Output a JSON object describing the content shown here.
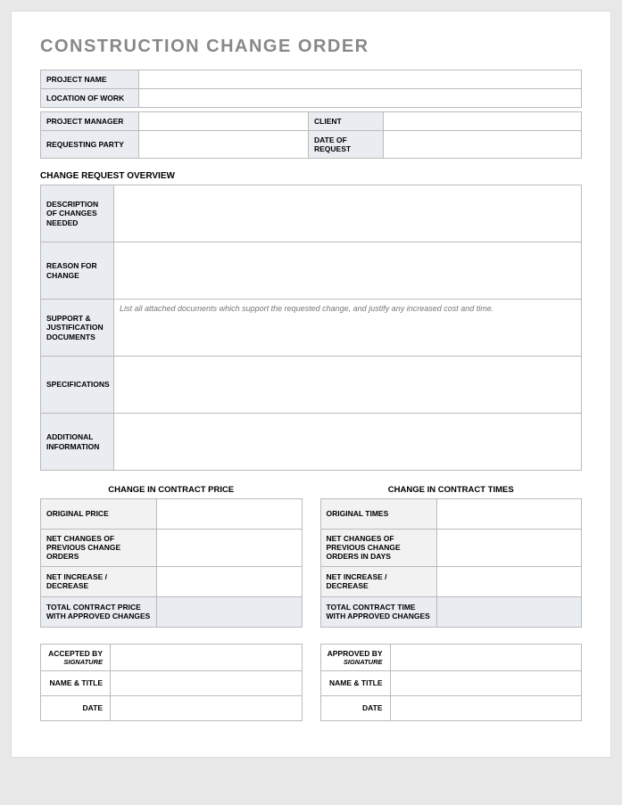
{
  "title": "CONSTRUCTION CHANGE ORDER",
  "header": {
    "projectNameLabel": "PROJECT NAME",
    "projectName": "",
    "locationLabel": "LOCATION OF WORK",
    "location": "",
    "projectManagerLabel": "PROJECT MANAGER",
    "projectManager": "",
    "clientLabel": "CLIENT",
    "client": "",
    "requestingPartyLabel": "REQUESTING PARTY",
    "requestingParty": "",
    "dateOfRequestLabel": "DATE OF REQUEST",
    "dateOfRequest": ""
  },
  "overview": {
    "sectionTitle": "CHANGE REQUEST OVERVIEW",
    "descriptionLabel": "DESCRIPTION OF CHANGES NEEDED",
    "description": "",
    "reasonLabel": "REASON FOR CHANGE",
    "reason": "",
    "supportLabel": "SUPPORT & JUSTIFICATION DOCUMENTS",
    "supportHint": "List all attached documents which support the requested change, and justify any increased cost and time.",
    "specificationsLabel": "SPECIFICATIONS",
    "specifications": "",
    "additionalLabel": "ADDITIONAL INFORMATION",
    "additional": ""
  },
  "price": {
    "title": "CHANGE IN CONTRACT PRICE",
    "originalLabel": "ORIGINAL PRICE",
    "original": "",
    "netChangesLabel": "NET CHANGES OF PREVIOUS CHANGE ORDERS",
    "netChanges": "",
    "netIncDecLabel": "NET INCREASE / DECREASE",
    "netIncDec": "",
    "totalLabel": "TOTAL CONTRACT PRICE WITH APPROVED CHANGES",
    "total": ""
  },
  "times": {
    "title": "CHANGE IN CONTRACT TIMES",
    "originalLabel": "ORIGINAL TIMES",
    "original": "",
    "netChangesLabel": "NET CHANGES OF PREVIOUS CHANGE ORDERS IN DAYS",
    "netChanges": "",
    "netIncDecLabel": "NET INCREASE / DECREASE",
    "netIncDec": "",
    "totalLabel": "TOTAL CONTRACT TIME WITH APPROVED CHANGES",
    "total": ""
  },
  "accepted": {
    "byLabel": "ACCEPTED BY",
    "sigSub": "SIGNATURE",
    "by": "",
    "nameTitleLabel": "NAME & TITLE",
    "nameTitle": "",
    "dateLabel": "DATE",
    "date": ""
  },
  "approved": {
    "byLabel": "APPROVED BY",
    "sigSub": "SIGNATURE",
    "by": "",
    "nameTitleLabel": "NAME & TITLE",
    "nameTitle": "",
    "dateLabel": "DATE",
    "date": ""
  }
}
